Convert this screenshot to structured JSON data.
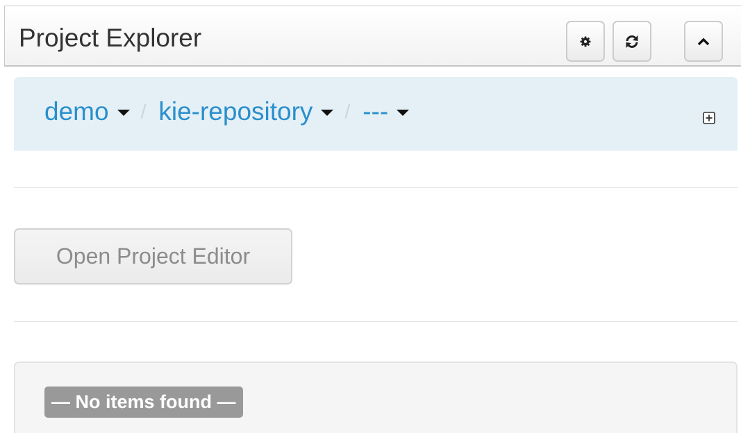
{
  "panel": {
    "title": "Project Explorer",
    "buttons": [
      {
        "name": "settings",
        "icon": "gear-icon"
      },
      {
        "name": "refresh",
        "icon": "refresh-icon"
      },
      {
        "name": "collapse",
        "icon": "chevron-up-icon"
      }
    ]
  },
  "breadcrumb": {
    "items": [
      {
        "label": "demo"
      },
      {
        "label": "kie-repository"
      },
      {
        "label": "---"
      }
    ],
    "separator": "/",
    "expand_icon": "plus-square-icon"
  },
  "actions": {
    "open_project_editor": "Open Project Editor"
  },
  "items": {
    "empty_message": "— No items found —"
  },
  "colors": {
    "link": "#2a8fcc",
    "breadcrumb_bg": "#e4f0f6",
    "label_bg": "#999999"
  }
}
